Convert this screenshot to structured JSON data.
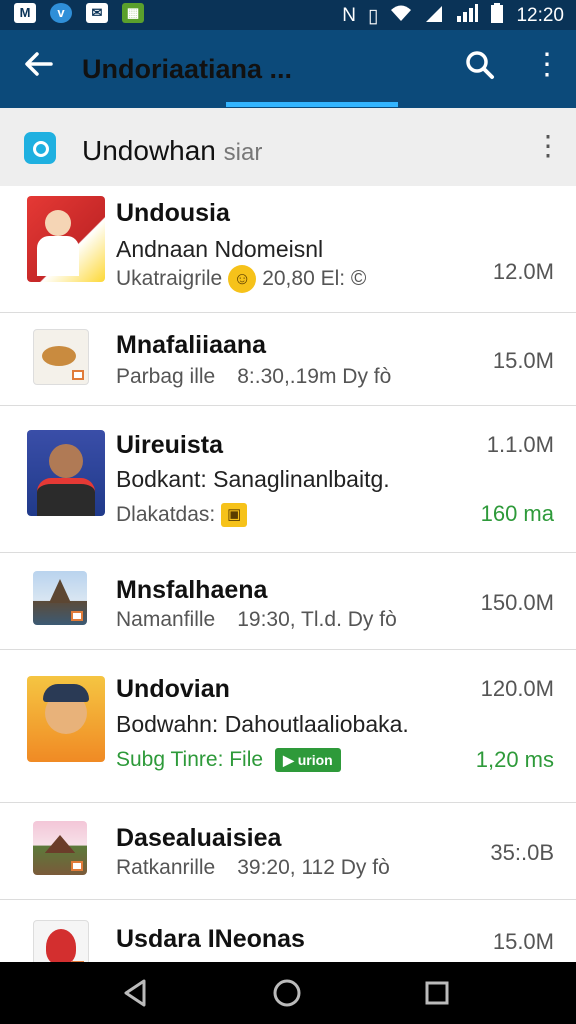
{
  "status_bar": {
    "left_icons": [
      "gmail-icon",
      "v-app-icon",
      "message-icon",
      "gallery-icon"
    ],
    "time": "12:20"
  },
  "toolbar": {
    "title": "Undoriaatiana ..."
  },
  "section_header": {
    "name": "Undowhan",
    "suffix": "siar"
  },
  "items": [
    {
      "title": "Undousia",
      "subtitle": "Andnaan Ndomeisnl",
      "meta_left": "Ukatraigrile",
      "meta_badge": "☺",
      "meta_right": "20,80 El: ©",
      "size": "12.0M"
    },
    {
      "title": "Mnafaliiaana",
      "meta_left": "Parbag ille",
      "meta_right": "8:.30,.19m Dy fò",
      "size": "15.0M"
    },
    {
      "title": "Uireuista",
      "subtitle": "Bodkant: Sanaglinanlbaitg.",
      "meta_left": "Dlakatdas:",
      "meta_badge": "▣",
      "size_top": "1.1.0M",
      "size_bottom": "160 ma"
    },
    {
      "title": "Mnsfalhaena",
      "meta_left": "Namanfille",
      "meta_right": "19:30, Tl.d. Dy fò",
      "size": "150.0M"
    },
    {
      "title": "Undovian",
      "subtitle": "Bodwahn: Dahoutlaaliobaka.",
      "meta_left": "Subg Tinre: File",
      "meta_badge": "▶ urion",
      "size_top": "120.0M",
      "size_bottom": "1,20 ms"
    },
    {
      "title": "Dasealuaisiea",
      "meta_left": "Ratkanrille",
      "meta_right": "39:20, 112  Dy fò",
      "size": "35:.0B"
    },
    {
      "title": "Usdara INeonas",
      "size": "15.0M"
    }
  ]
}
